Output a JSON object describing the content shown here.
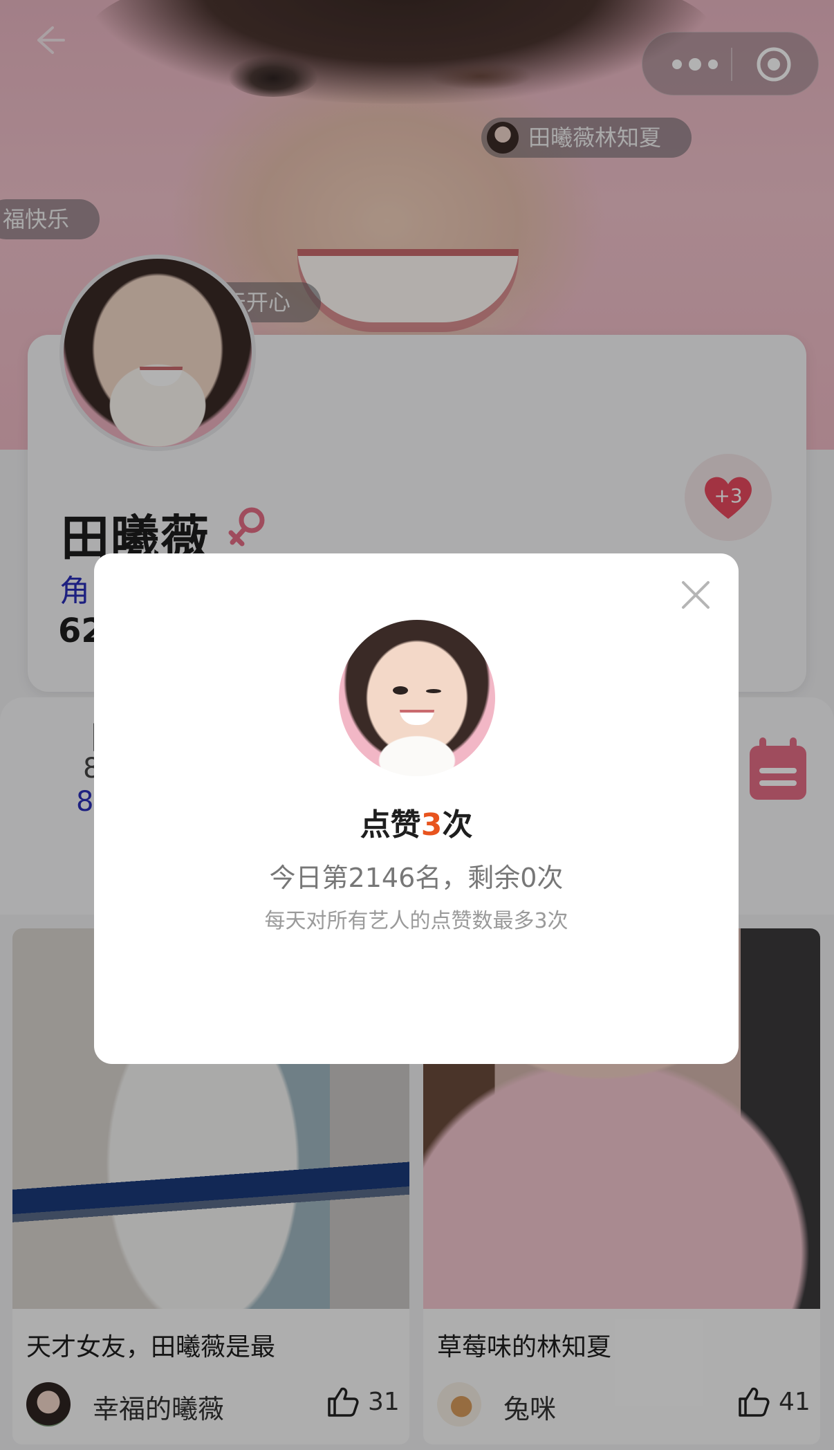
{
  "hero": {
    "danmaku": [
      {
        "text": "田曦薇林知夏"
      },
      {
        "text": "福快乐"
      },
      {
        "text": "天开心"
      }
    ]
  },
  "profile": {
    "name": "田曦薇",
    "role_partial": "角",
    "count_partial": "62",
    "like_badge": "+3"
  },
  "stats": {
    "line_a": "|",
    "line_b": "8",
    "line_c": "8"
  },
  "feed": [
    {
      "title": "天才女友，田曦薇是最",
      "user": "幸福的曦薇",
      "likes": "31"
    },
    {
      "title": "草莓味的林知夏",
      "user": "兔咪",
      "likes": "41"
    }
  ],
  "modal": {
    "title_prefix": "点赞",
    "title_num": "3",
    "title_suffix": "次",
    "rank_text": "今日第2146名，剩余0次",
    "note": "每天对所有艺人的点赞数最多3次"
  },
  "colors": {
    "accent_orange": "#e8541e",
    "heart_red": "#e84a5f",
    "link_blue": "#2a2fb8",
    "calendar_pink": "#e46d86"
  },
  "icons": [
    "back-arrow-icon",
    "more-dots-icon",
    "target-icon",
    "female-icon",
    "heart-icon",
    "calendar-icon",
    "thumbs-up-icon",
    "close-icon"
  ]
}
